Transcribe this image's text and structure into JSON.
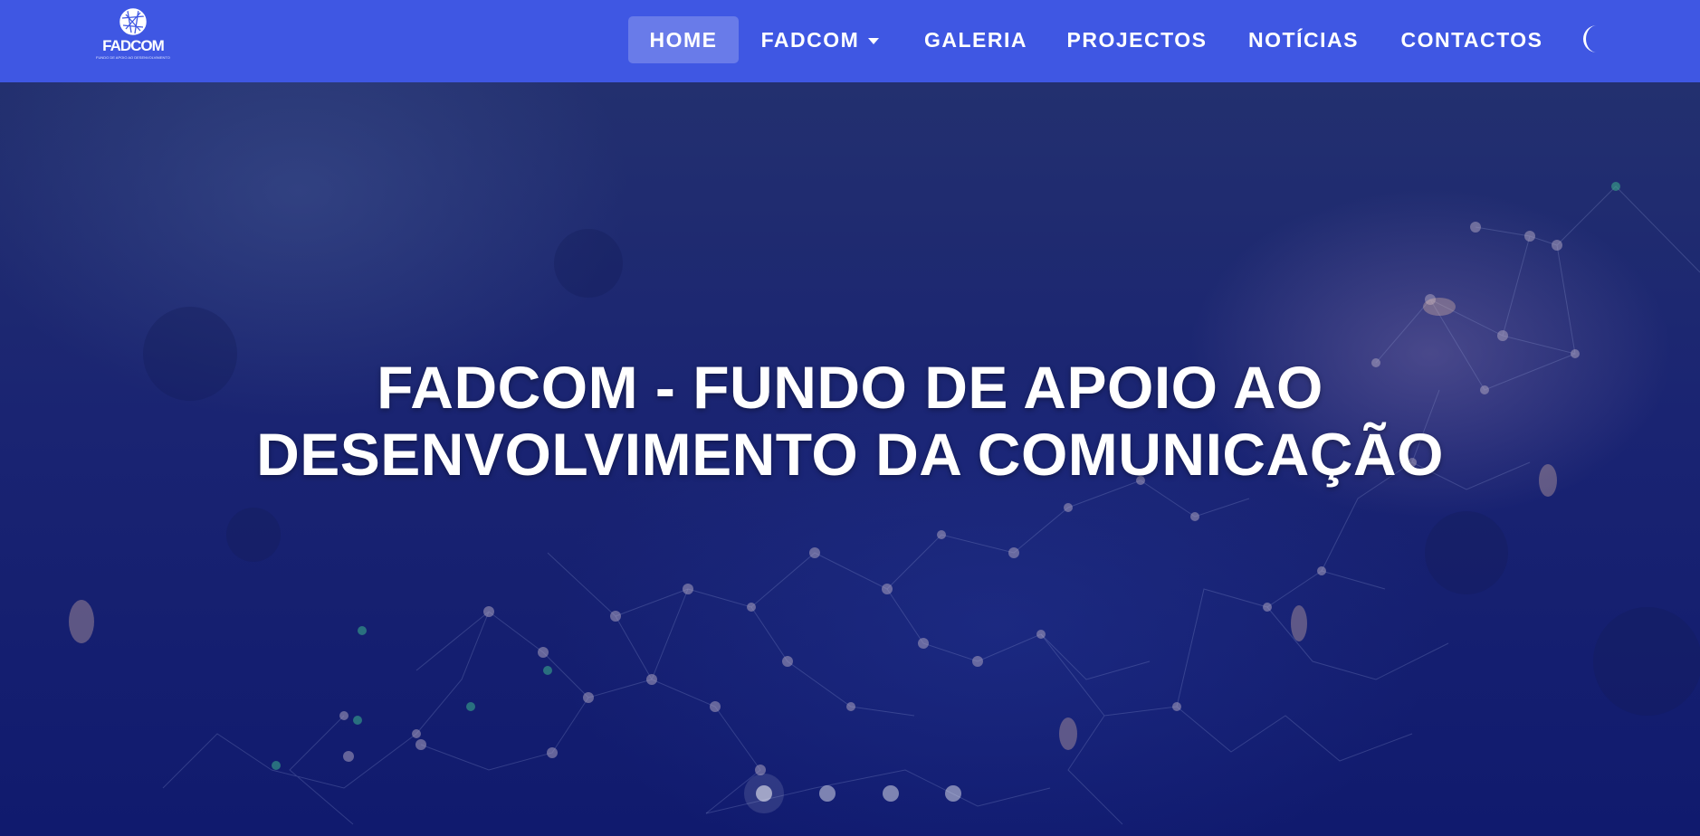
{
  "navbar": {
    "logo": {
      "text": "FADCOM",
      "subtitle": "FUNDO DE APOIO AO DESENVOLVIMENTO DA COMUNICAÇÃO"
    },
    "items": [
      {
        "label": "HOME",
        "active": true
      },
      {
        "label": "FADCOM",
        "dropdown": true
      },
      {
        "label": "GALERIA"
      },
      {
        "label": "PROJECTOS"
      },
      {
        "label": "NOTÍCIAS"
      },
      {
        "label": "CONTACTOS"
      }
    ],
    "theme_toggle_icon": "moon-icon"
  },
  "hero": {
    "title_line1": "FADCOM - FUNDO DE APOIO AO",
    "title_line2": "DESENVOLVIMENTO DA COMUNICAÇÃO",
    "carousel": {
      "slide_count": 4,
      "active_index": 0
    }
  },
  "colors": {
    "navbar_bg": "#3f57e3",
    "hero_bg": "#1a2472",
    "text": "#ffffff"
  }
}
